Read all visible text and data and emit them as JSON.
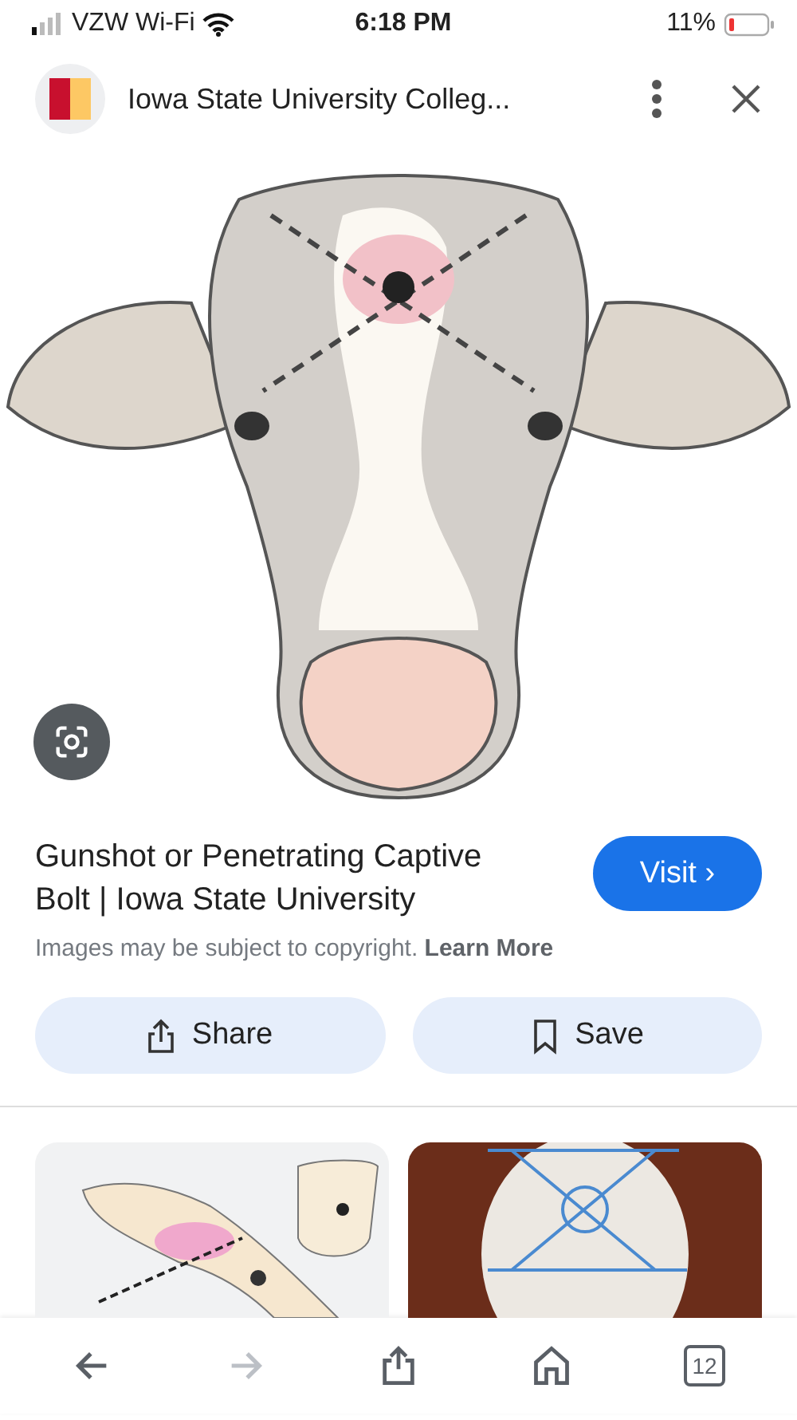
{
  "status_bar": {
    "carrier": "VZW Wi-Fi",
    "time": "6:18 PM",
    "battery": "11%"
  },
  "header": {
    "title": "Iowa State University Colleg..."
  },
  "result": {
    "title": "Gunshot or Penetrating Captive Bolt | Iowa State University",
    "visit_label": "Visit",
    "visit_chevron": "›",
    "copyright": "Images may be subject to copyright.",
    "learn_more": "Learn More"
  },
  "actions": [
    {
      "kind": "share",
      "label": "Share"
    },
    {
      "kind": "save",
      "label": "Save"
    }
  ],
  "related": [
    {
      "kind": "illustration"
    },
    {
      "kind": "photo"
    }
  ],
  "toolbar": [
    {
      "kind": "back",
      "disabled": false
    },
    {
      "kind": "forward",
      "disabled": true
    },
    {
      "kind": "share",
      "disabled": false
    },
    {
      "kind": "home",
      "disabled": false
    },
    {
      "kind": "tabs",
      "disabled": false,
      "count": "12"
    }
  ]
}
